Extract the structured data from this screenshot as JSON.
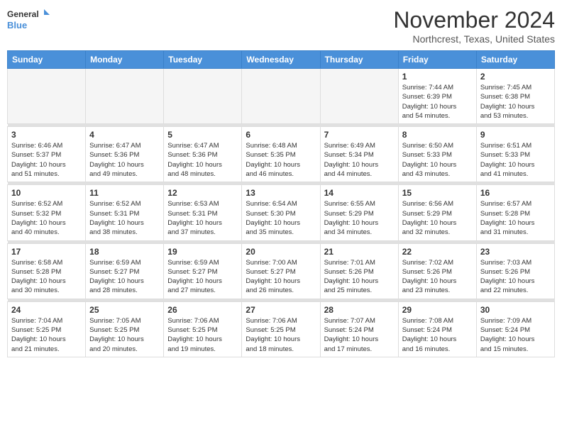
{
  "logo": {
    "line1": "General",
    "line2": "Blue"
  },
  "title": "November 2024",
  "location": "Northcrest, Texas, United States",
  "weekdays": [
    "Sunday",
    "Monday",
    "Tuesday",
    "Wednesday",
    "Thursday",
    "Friday",
    "Saturday"
  ],
  "weeks": [
    [
      {
        "day": "",
        "info": ""
      },
      {
        "day": "",
        "info": ""
      },
      {
        "day": "",
        "info": ""
      },
      {
        "day": "",
        "info": ""
      },
      {
        "day": "",
        "info": ""
      },
      {
        "day": "1",
        "info": "Sunrise: 7:44 AM\nSunset: 6:39 PM\nDaylight: 10 hours\nand 54 minutes."
      },
      {
        "day": "2",
        "info": "Sunrise: 7:45 AM\nSunset: 6:38 PM\nDaylight: 10 hours\nand 53 minutes."
      }
    ],
    [
      {
        "day": "3",
        "info": "Sunrise: 6:46 AM\nSunset: 5:37 PM\nDaylight: 10 hours\nand 51 minutes."
      },
      {
        "day": "4",
        "info": "Sunrise: 6:47 AM\nSunset: 5:36 PM\nDaylight: 10 hours\nand 49 minutes."
      },
      {
        "day": "5",
        "info": "Sunrise: 6:47 AM\nSunset: 5:36 PM\nDaylight: 10 hours\nand 48 minutes."
      },
      {
        "day": "6",
        "info": "Sunrise: 6:48 AM\nSunset: 5:35 PM\nDaylight: 10 hours\nand 46 minutes."
      },
      {
        "day": "7",
        "info": "Sunrise: 6:49 AM\nSunset: 5:34 PM\nDaylight: 10 hours\nand 44 minutes."
      },
      {
        "day": "8",
        "info": "Sunrise: 6:50 AM\nSunset: 5:33 PM\nDaylight: 10 hours\nand 43 minutes."
      },
      {
        "day": "9",
        "info": "Sunrise: 6:51 AM\nSunset: 5:33 PM\nDaylight: 10 hours\nand 41 minutes."
      }
    ],
    [
      {
        "day": "10",
        "info": "Sunrise: 6:52 AM\nSunset: 5:32 PM\nDaylight: 10 hours\nand 40 minutes."
      },
      {
        "day": "11",
        "info": "Sunrise: 6:52 AM\nSunset: 5:31 PM\nDaylight: 10 hours\nand 38 minutes."
      },
      {
        "day": "12",
        "info": "Sunrise: 6:53 AM\nSunset: 5:31 PM\nDaylight: 10 hours\nand 37 minutes."
      },
      {
        "day": "13",
        "info": "Sunrise: 6:54 AM\nSunset: 5:30 PM\nDaylight: 10 hours\nand 35 minutes."
      },
      {
        "day": "14",
        "info": "Sunrise: 6:55 AM\nSunset: 5:29 PM\nDaylight: 10 hours\nand 34 minutes."
      },
      {
        "day": "15",
        "info": "Sunrise: 6:56 AM\nSunset: 5:29 PM\nDaylight: 10 hours\nand 32 minutes."
      },
      {
        "day": "16",
        "info": "Sunrise: 6:57 AM\nSunset: 5:28 PM\nDaylight: 10 hours\nand 31 minutes."
      }
    ],
    [
      {
        "day": "17",
        "info": "Sunrise: 6:58 AM\nSunset: 5:28 PM\nDaylight: 10 hours\nand 30 minutes."
      },
      {
        "day": "18",
        "info": "Sunrise: 6:59 AM\nSunset: 5:27 PM\nDaylight: 10 hours\nand 28 minutes."
      },
      {
        "day": "19",
        "info": "Sunrise: 6:59 AM\nSunset: 5:27 PM\nDaylight: 10 hours\nand 27 minutes."
      },
      {
        "day": "20",
        "info": "Sunrise: 7:00 AM\nSunset: 5:27 PM\nDaylight: 10 hours\nand 26 minutes."
      },
      {
        "day": "21",
        "info": "Sunrise: 7:01 AM\nSunset: 5:26 PM\nDaylight: 10 hours\nand 25 minutes."
      },
      {
        "day": "22",
        "info": "Sunrise: 7:02 AM\nSunset: 5:26 PM\nDaylight: 10 hours\nand 23 minutes."
      },
      {
        "day": "23",
        "info": "Sunrise: 7:03 AM\nSunset: 5:26 PM\nDaylight: 10 hours\nand 22 minutes."
      }
    ],
    [
      {
        "day": "24",
        "info": "Sunrise: 7:04 AM\nSunset: 5:25 PM\nDaylight: 10 hours\nand 21 minutes."
      },
      {
        "day": "25",
        "info": "Sunrise: 7:05 AM\nSunset: 5:25 PM\nDaylight: 10 hours\nand 20 minutes."
      },
      {
        "day": "26",
        "info": "Sunrise: 7:06 AM\nSunset: 5:25 PM\nDaylight: 10 hours\nand 19 minutes."
      },
      {
        "day": "27",
        "info": "Sunrise: 7:06 AM\nSunset: 5:25 PM\nDaylight: 10 hours\nand 18 minutes."
      },
      {
        "day": "28",
        "info": "Sunrise: 7:07 AM\nSunset: 5:24 PM\nDaylight: 10 hours\nand 17 minutes."
      },
      {
        "day": "29",
        "info": "Sunrise: 7:08 AM\nSunset: 5:24 PM\nDaylight: 10 hours\nand 16 minutes."
      },
      {
        "day": "30",
        "info": "Sunrise: 7:09 AM\nSunset: 5:24 PM\nDaylight: 10 hours\nand 15 minutes."
      }
    ]
  ]
}
